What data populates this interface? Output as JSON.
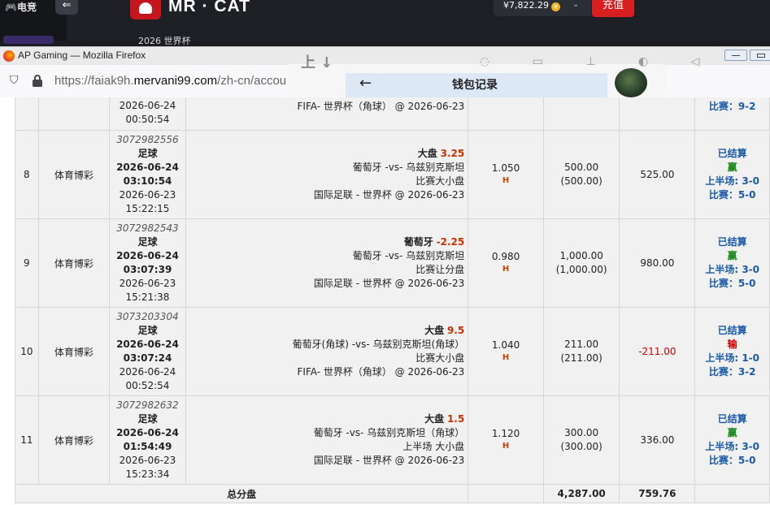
{
  "topbar": {
    "elec_label": "电竞",
    "back_glyph": "⇐",
    "brand": "MR · CAT",
    "subtitle": "2026 世界杯",
    "balance": "¥7,822.29",
    "coin_glyph": "¥",
    "chevron_glyph": "⌄",
    "recharge_label": "充值"
  },
  "firefox": {
    "window_title": "AP Gaming — Mozilla Firefox",
    "url_prefix": "https://faiak9h.",
    "url_domain": "mervani99.com",
    "url_suffix": "/zh-cn/accou"
  },
  "wallet": {
    "title": "钱包记录",
    "back_glyph": "←",
    "faded_text": "上 ↓",
    "faded_icons": "◌ ▭ ⊥ ◐ ◁"
  },
  "colors": {
    "accent_red": "#d81e1e",
    "status_blue": "#1a5aa8",
    "win_green": "#1a8a1a",
    "loss_red": "#d40000",
    "handicap_orange": "#c83200"
  },
  "partial_row": {
    "date1": "2026-06-24",
    "time1": "00:50:54",
    "league": "FIFA- 世界杯（角球） @ 2026-06-23",
    "score": "比赛：9-2"
  },
  "rows": [
    {
      "index": "8",
      "type": "体育博彩",
      "bet_id": "3072982556",
      "sport": "足球",
      "date1": "2026-06-24",
      "time1": "03:10:54",
      "date2": "2026-06-23",
      "time2": "15:22:15",
      "market_label": "大盘",
      "handicap": "3.25",
      "match": "葡萄牙 -vs- 乌兹别克斯坦",
      "bet_type": "比赛大小盘",
      "league": "国际足联 - 世界杯 @ 2026-06-23",
      "odds": "1.050",
      "odds_type": "H",
      "stake": "500.00",
      "stake_paren": "(500.00)",
      "winloss": "525.00",
      "status": "已结算",
      "result": "赢",
      "half_score": "上半场: 3-0",
      "full_score": "比赛：5-0"
    },
    {
      "index": "9",
      "type": "体育博彩",
      "bet_id": "3072982543",
      "sport": "足球",
      "date1": "2026-06-24",
      "time1": "03:07:39",
      "date2": "2026-06-23",
      "time2": "15:21:38",
      "market_label": "葡萄牙",
      "handicap": "-2.25",
      "match": "葡萄牙 -vs- 乌兹别克斯坦",
      "bet_type": "比赛让分盘",
      "league": "国际足联 - 世界杯 @ 2026-06-23",
      "odds": "0.980",
      "odds_type": "H",
      "stake": "1,000.00",
      "stake_paren": "(1,000.00)",
      "winloss": "980.00",
      "status": "已结算",
      "result": "赢",
      "half_score": "上半场: 3-0",
      "full_score": "比赛：5-0"
    },
    {
      "index": "10",
      "type": "体育博彩",
      "bet_id": "3073203304",
      "sport": "足球",
      "date1": "2026-06-24",
      "time1": "03:07:24",
      "date2": "2026-06-24",
      "time2": "00:52:54",
      "market_label": "大盘",
      "handicap": "9.5",
      "match": "葡萄牙(角球) -vs- 乌兹别克斯坦(角球）",
      "bet_type": "比赛大小盘",
      "league": "FIFA- 世界杯（角球） @ 2026-06-23",
      "odds": "1.040",
      "odds_type": "H",
      "stake": "211.00",
      "stake_paren": "(211.00)",
      "winloss": "-211.00",
      "status": "已结算",
      "result": "输",
      "half_score": "上半场: 1-0",
      "full_score": "比赛：3-2"
    },
    {
      "index": "11",
      "type": "体育博彩",
      "bet_id": "3072982632",
      "sport": "足球",
      "date1": "2026-06-24",
      "time1": "01:54:49",
      "date2": "2026-06-23",
      "time2": "15:23:34",
      "market_label": "大盘",
      "handicap": "1.5",
      "match": "葡萄牙 -vs- 乌兹别克斯坦（角球）",
      "bet_type": "上半场 大小盘",
      "league": "国际足联 - 世界杯 @ 2026-06-23",
      "odds": "1.120",
      "odds_type": "H",
      "stake": "300.00",
      "stake_paren": "(300.00)",
      "winloss": "336.00",
      "status": "已结算",
      "result": "赢",
      "half_score": "上半场: 3-0",
      "full_score": "比赛：5-0"
    }
  ],
  "total": {
    "label": "总分盘",
    "stake": "4,287.00",
    "winloss": "759.76"
  }
}
